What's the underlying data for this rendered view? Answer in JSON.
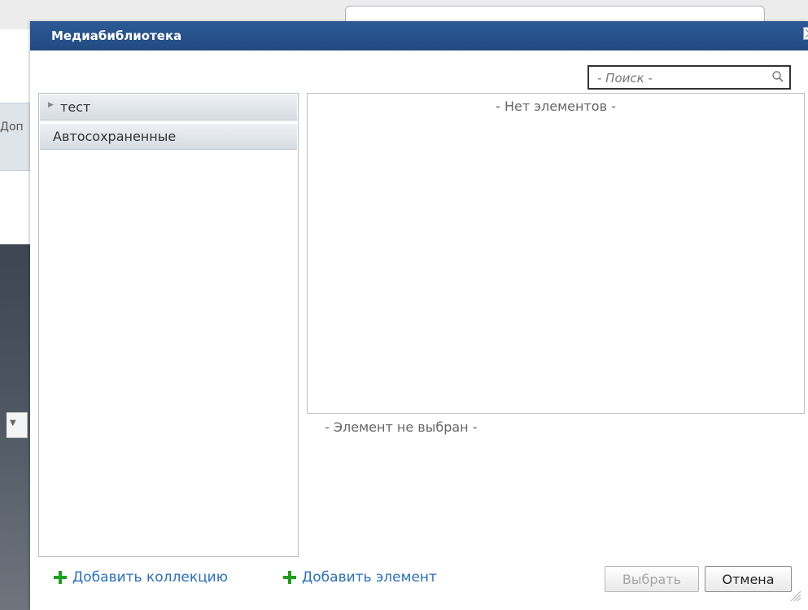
{
  "background": {
    "tab_fragment": "Доп"
  },
  "dialog": {
    "title": "Медиабиблиотека",
    "search": {
      "placeholder": "- Поиск -"
    },
    "collections": [
      {
        "label": "тест",
        "expandable": true
      },
      {
        "label": "Автосохраненные",
        "expandable": false
      }
    ],
    "elements_empty_text": "- Нет элементов -",
    "selection_empty_text": "- Элемент не выбран -",
    "actions": {
      "add_collection": "Добавить коллекцию",
      "add_element": "Добавить элемент",
      "select_button": "Выбрать",
      "cancel_button": "Отмена"
    }
  },
  "icons": {
    "close": "close-icon",
    "search": "search-icon",
    "add": "plus-icon",
    "caret": "caret-right-icon",
    "resize": "resize-grip-icon"
  },
  "colors": {
    "titlebar": "#214a80",
    "link": "#2a6fc4",
    "plus": "#1e9e1e",
    "disabled_text": "#a5a5a5"
  }
}
